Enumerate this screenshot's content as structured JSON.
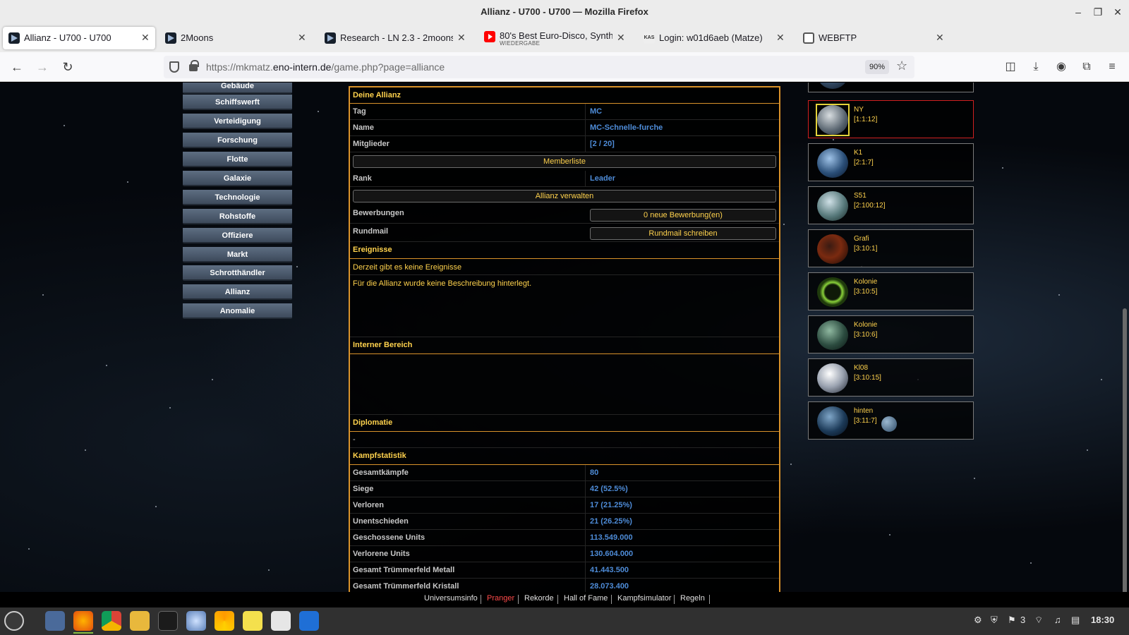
{
  "window": {
    "title": "Allianz - U700 - U700 — Mozilla Firefox"
  },
  "tabs": [
    {
      "label": "Allianz - U700 - U700",
      "icon": "2moons-icon"
    },
    {
      "label": "2Moons",
      "icon": "2moons-icon"
    },
    {
      "label": "Research - LN 2.3 - 2moons",
      "icon": "2moons-icon"
    },
    {
      "label": "80's Best Euro-Disco, Synth",
      "sublabel": "WIEDERGABE",
      "icon": "youtube-icon"
    },
    {
      "label": "Login: w01d6aeb (Matze)",
      "icon": "kas-icon"
    },
    {
      "label": "WEBFTP",
      "icon": "ftp-icon"
    }
  ],
  "favicon_kas": "KAS",
  "url": {
    "prefix": "https://mkmatz.",
    "domain": "eno-intern.de",
    "path": "/game.php?page=alliance",
    "zoom": "90%"
  },
  "menu": [
    "Gebäude",
    "Schiffswerft",
    "Verteidigung",
    "Forschung",
    "Flotte",
    "Galaxie",
    "Technologie",
    "Rohstoffe",
    "Offiziere",
    "Markt",
    "Schrotthändler",
    "Allianz",
    "Anomalie"
  ],
  "alliance": {
    "header": "Deine Allianz",
    "tag_label": "Tag",
    "tag": "MC",
    "name_label": "Name",
    "name": "MC-Schnelle-furche",
    "members_label": "Mitglieder",
    "members": "[2 / 20]",
    "memberlist_button": "Memberliste",
    "rank_label": "Rank",
    "rank": "Leader",
    "manage_button": "Allianz verwalten",
    "applications_label": "Bewerbungen",
    "applications_button": "0 neue Bewerbung(en)",
    "rundmail_label": "Rundmail",
    "rundmail_button": "Rundmail schreiben"
  },
  "events": {
    "header": "Ereignisse",
    "text": "Derzeit gibt es keine Ereignisse",
    "description": "Für die Allianz wurde keine Beschreibung hinterlegt."
  },
  "internal": {
    "header": "Interner Bereich"
  },
  "diplomacy": {
    "header": "Diplomatie",
    "text": "-"
  },
  "battle": {
    "header": "Kampfstatistik",
    "rows": [
      {
        "label": "Gesamtkämpfe",
        "value": "80"
      },
      {
        "label": "Siege",
        "value": "42 (52.5%)"
      },
      {
        "label": "Verloren",
        "value": "17 (21.25%)"
      },
      {
        "label": "Unentschieden",
        "value": "21 (26.25%)"
      },
      {
        "label": "Geschossene Units",
        "value": "113.549.000"
      },
      {
        "label": "Verlorene Units",
        "value": "130.604.000"
      },
      {
        "label": "Gesamt Trümmerfeld Metall",
        "value": "41.443.500"
      },
      {
        "label": "Gesamt Trümmerfeld Kristall",
        "value": "28.073.400"
      }
    ]
  },
  "planets": [
    {
      "name": "NY",
      "coords": "[1:1:12]",
      "selected": true
    },
    {
      "name": "K1",
      "coords": "[2:1:7]"
    },
    {
      "name": "S51",
      "coords": "[2:100:12]"
    },
    {
      "name": "Grafi",
      "coords": "[3:10:1]"
    },
    {
      "name": "Kolonie",
      "coords": "[3:10:5]"
    },
    {
      "name": "Kolonie",
      "coords": "[3:10:6]"
    },
    {
      "name": "Kl08",
      "coords": "[3:10:15]"
    },
    {
      "name": "hinten",
      "coords": "[3:11:7]"
    }
  ],
  "footer": [
    "Universumsinfo",
    "Pranger",
    "Rekorde",
    "Hall of Fame",
    "Kampfsimulator",
    "Regeln"
  ],
  "colors": {
    "accent_orange": "#d9922a",
    "header_yellow": "#ffd24d",
    "value_blue": "#4e8cd8",
    "pranger_red": "#ff4a4a"
  },
  "taskbar": {
    "wifi_count": "3",
    "clock": "18:30"
  }
}
